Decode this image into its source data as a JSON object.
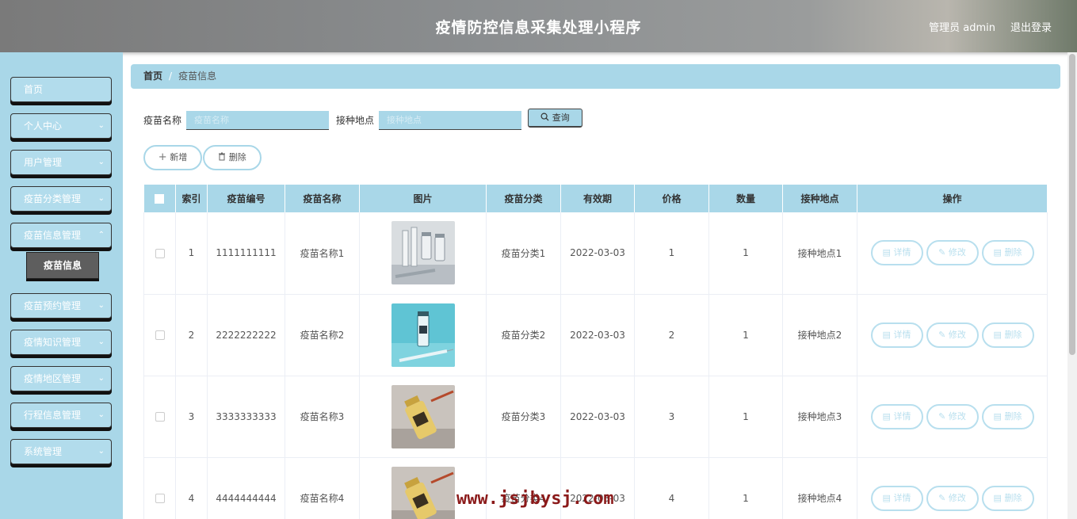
{
  "header": {
    "title": "疫情防控信息采集处理小程序",
    "user": "管理员 admin",
    "logout": "退出登录"
  },
  "sidebar": {
    "items": [
      {
        "label": "首页",
        "has_chevron": false
      },
      {
        "label": "个人中心",
        "has_chevron": true
      },
      {
        "label": "用户管理",
        "has_chevron": true
      },
      {
        "label": "疫苗分类管理",
        "has_chevron": true
      },
      {
        "label": "疫苗信息管理",
        "has_chevron": true
      },
      {
        "label": "疫苗预约管理",
        "has_chevron": true
      },
      {
        "label": "疫情知识管理",
        "has_chevron": true
      },
      {
        "label": "疫情地区管理",
        "has_chevron": true
      },
      {
        "label": "行程信息管理",
        "has_chevron": true
      },
      {
        "label": "系统管理",
        "has_chevron": true
      }
    ],
    "active_sub": "疫苗信息"
  },
  "breadcrumb": {
    "home": "首页",
    "separator": "/",
    "current": "疫苗信息"
  },
  "search": {
    "name_label": "疫苗名称",
    "name_placeholder": "疫苗名称",
    "place_label": "接种地点",
    "place_placeholder": "接种地点",
    "query_button": "查询"
  },
  "actions": {
    "add": "新增",
    "delete": "删除"
  },
  "table": {
    "headers": [
      "",
      "索引",
      "疫苗编号",
      "疫苗名称",
      "图片",
      "疫苗分类",
      "有效期",
      "价格",
      "数量",
      "接种地点",
      "操作"
    ],
    "rows": [
      {
        "index": "1",
        "code": "1111111111",
        "name": "疫苗名称1",
        "category": "疫苗分类1",
        "expiry": "2022-03-03",
        "price": "1",
        "qty": "1",
        "place": "接种地点1"
      },
      {
        "index": "2",
        "code": "2222222222",
        "name": "疫苗名称2",
        "category": "疫苗分类2",
        "expiry": "2022-03-03",
        "price": "2",
        "qty": "1",
        "place": "接种地点2"
      },
      {
        "index": "3",
        "code": "3333333333",
        "name": "疫苗名称3",
        "category": "疫苗分类3",
        "expiry": "2022-03-03",
        "price": "3",
        "qty": "1",
        "place": "接种地点3"
      },
      {
        "index": "4",
        "code": "4444444444",
        "name": "疫苗名称4",
        "category": "疫苗分类4",
        "expiry": "2022-03-03",
        "price": "4",
        "qty": "1",
        "place": "接种地点4"
      }
    ],
    "op_labels": {
      "detail": "详情",
      "edit": "修改",
      "delete": "删除"
    }
  },
  "watermark": "www.jsjbysj.com",
  "colors": {
    "accent": "#a9d7e8",
    "op_border": "#b8dfee",
    "watermark": "#8b1a1a"
  }
}
